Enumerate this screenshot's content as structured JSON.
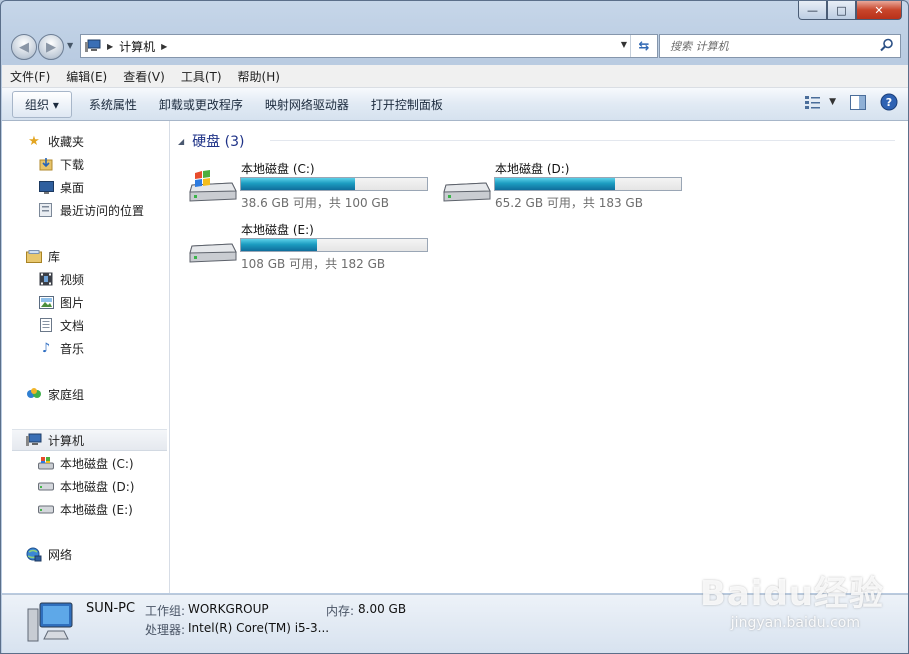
{
  "window": {
    "minimize": "—",
    "maximize": "□",
    "close": "✕"
  },
  "nav": {
    "back": "◀",
    "forward": "▶",
    "crumb": "计算机",
    "search_placeholder": "搜索 计算机"
  },
  "menu": [
    "文件(F)",
    "编辑(E)",
    "查看(V)",
    "工具(T)",
    "帮助(H)"
  ],
  "toolbar": {
    "organize": "组织 ▾",
    "items": [
      "系统属性",
      "卸载或更改程序",
      "映射网络驱动器",
      "打开控制面板"
    ]
  },
  "sidebar": {
    "favorites": "收藏夹",
    "downloads": "下载",
    "desktop": "桌面",
    "recent": "最近访问的位置",
    "libraries": "库",
    "videos": "视频",
    "pictures": "图片",
    "documents": "文档",
    "music": "音乐",
    "homegroup": "家庭组",
    "computer": "计算机",
    "drive_c": "本地磁盘 (C:)",
    "drive_d": "本地磁盘 (D:)",
    "drive_e": "本地磁盘 (E:)",
    "network": "网络"
  },
  "main": {
    "group_title": "硬盘 (3)",
    "drives": [
      {
        "name": "本地磁盘 (C:)",
        "info": "38.6 GB 可用，共 100 GB",
        "used_fraction": 0.614
      },
      {
        "name": "本地磁盘 (D:)",
        "info": "65.2 GB 可用，共 183 GB",
        "used_fraction": 0.644
      },
      {
        "name": "本地磁盘 (E:)",
        "info": "108 GB 可用，共 182 GB",
        "used_fraction": 0.407
      }
    ]
  },
  "details": {
    "pc_name": "SUN-PC",
    "workgroup_label": "工作组:",
    "workgroup": "WORKGROUP",
    "memory_label": "内存:",
    "memory": "8.00 GB",
    "cpu_label": "处理器:",
    "cpu": "Intel(R) Core(TM) i5-3..."
  },
  "watermark": {
    "brand": "Baidu经验",
    "url": "jingyan.baidu.com"
  },
  "colors": {
    "accent": "#1e3287",
    "bar_fill": "#1c9cc0"
  }
}
